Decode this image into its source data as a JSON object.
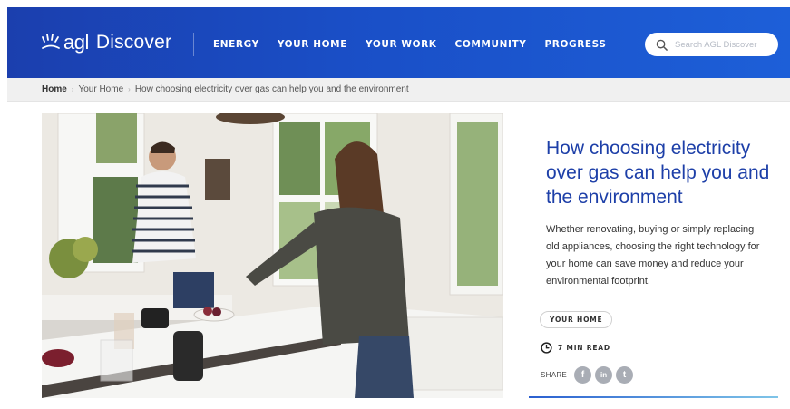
{
  "header": {
    "logo_agl": "agl",
    "logo_discover": "Discover",
    "nav": [
      {
        "label": "ENERGY"
      },
      {
        "label": "YOUR HOME"
      },
      {
        "label": "YOUR WORK"
      },
      {
        "label": "COMMUNITY"
      },
      {
        "label": "PROGRESS"
      }
    ],
    "search": {
      "placeholder": "Search AGL Discover",
      "value": ""
    }
  },
  "breadcrumb": {
    "items": [
      "Home",
      "Your Home",
      "How choosing electricity over gas can help you and the environment"
    ],
    "separator": "›"
  },
  "article": {
    "title": "How choosing electricity over gas can help you and the environment",
    "excerpt": "Whether renovating, buying or simply replacing old appliances, choosing the right technology for your home can save money and reduce your environmental footprint.",
    "tag": "YOUR HOME",
    "read_time": "7 MIN READ",
    "share_label": "SHARE",
    "share_buttons": [
      {
        "name": "facebook",
        "glyph": "f"
      },
      {
        "name": "linkedin",
        "glyph": "in"
      },
      {
        "name": "twitter",
        "glyph": "t"
      }
    ]
  },
  "colors": {
    "brand_blue": "#1b3fae",
    "title_blue": "#1d3fa8",
    "share_grey": "#a9adb5"
  },
  "icons": {
    "logo": "agl-rays-logo-icon",
    "search": "search-icon",
    "clock": "clock-icon"
  }
}
